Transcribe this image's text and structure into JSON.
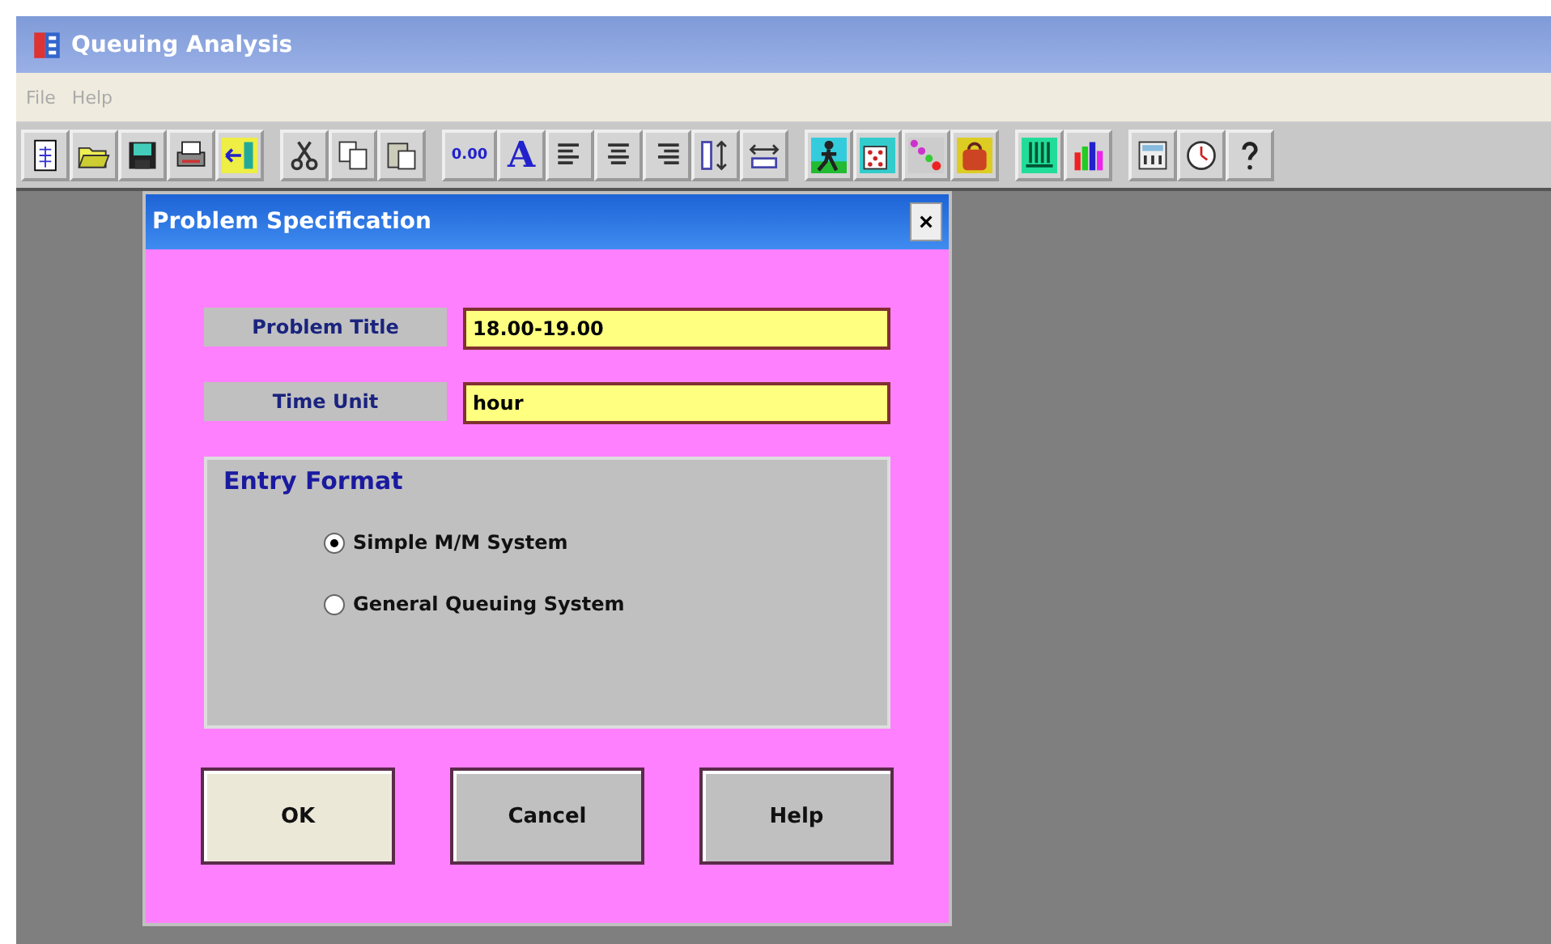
{
  "window": {
    "title": "Queuing Analysis"
  },
  "menu": [
    {
      "label": "File",
      "disabled": true
    },
    {
      "label": "Help",
      "disabled": true
    }
  ],
  "toolbar": {
    "number_format": "0.00",
    "font": "A"
  },
  "dialog": {
    "title": "Problem Specification",
    "close": "×",
    "fields": [
      {
        "label": "Problem Title",
        "value": "18.00-19.00"
      },
      {
        "label": "Time Unit",
        "value": "hour"
      }
    ],
    "group": {
      "title": "Entry Format",
      "options": [
        {
          "label": "Simple M/M System",
          "selected": true
        },
        {
          "label": "General Queuing System",
          "selected": false
        }
      ]
    },
    "buttons": [
      {
        "label": "OK",
        "default": true
      },
      {
        "label": "Cancel",
        "default": false
      },
      {
        "label": "Help",
        "default": false
      }
    ]
  }
}
